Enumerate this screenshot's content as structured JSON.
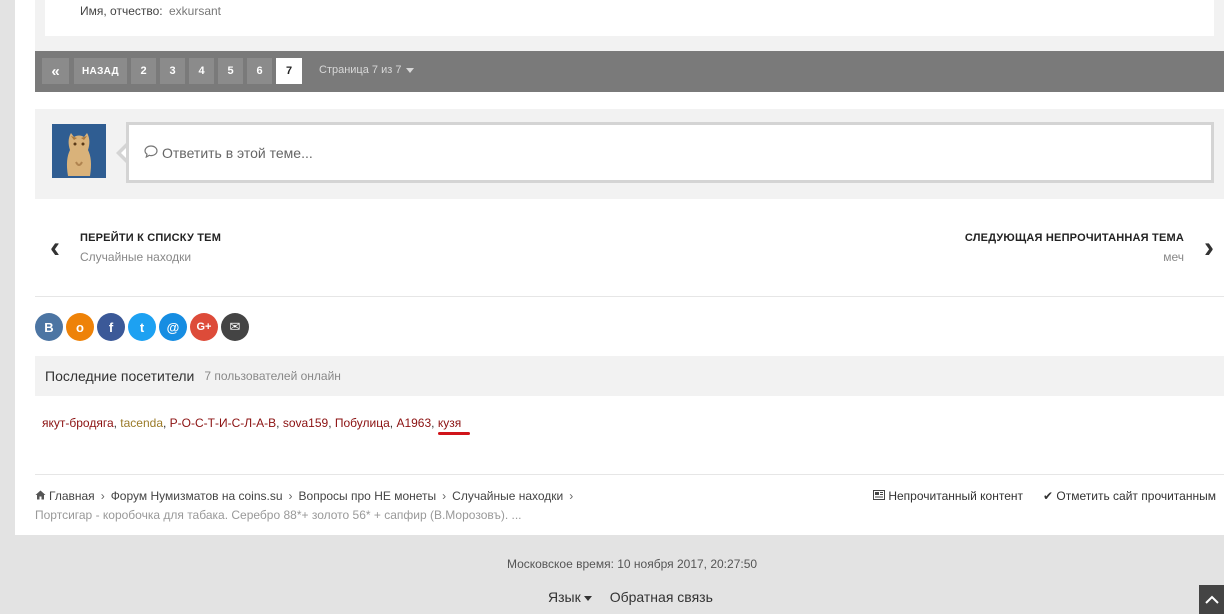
{
  "profile": {
    "label": "Имя, отчество:",
    "value": "exkursant"
  },
  "pagination": {
    "first_icon": "«",
    "back_label": "НАЗАД",
    "pages": [
      "2",
      "3",
      "4",
      "5",
      "6",
      "7"
    ],
    "active_page": "7",
    "page_info": "Страница 7 из 7"
  },
  "reply": {
    "placeholder": "Ответить в этой теме..."
  },
  "nav": {
    "prev_title": "ПЕРЕЙТИ К СПИСКУ ТЕМ",
    "prev_sub": "Случайные находки",
    "next_title": "СЛЕДУЮЩАЯ НЕПРОЧИТАННАЯ ТЕМА",
    "next_sub": "меч"
  },
  "social": [
    {
      "name": "vk",
      "glyph": "В",
      "color": "#4c75a3"
    },
    {
      "name": "odnoklassniki",
      "glyph": "о",
      "color": "#ee8208"
    },
    {
      "name": "facebook",
      "glyph": "f",
      "color": "#3b5998"
    },
    {
      "name": "twitter",
      "glyph": "t",
      "color": "#1da1f2"
    },
    {
      "name": "mail",
      "glyph": "@",
      "color": "#168de2"
    },
    {
      "name": "google-plus",
      "glyph": "G+",
      "color": "#dd4b39"
    },
    {
      "name": "email",
      "glyph": "✉",
      "color": "#444444"
    }
  ],
  "visitors": {
    "title": "Последние посетители",
    "count": "7 пользователей онлайн",
    "users": [
      "якут-бродяга",
      "tacenda",
      "Р-О-С-Т-И-С-Л-А-В",
      "sova159",
      "Побулица",
      "А1963",
      "кузя"
    ]
  },
  "breadcrumb": {
    "items": [
      "Главная",
      "Форум Нумизматов на coins.su",
      "Вопросы про НЕ монеты",
      "Случайные находки"
    ],
    "topic": "Портсигар - коробочка для табака. Серебро 88*+ золото 56* + сапфир (В.Морозовъ). ..."
  },
  "right_links": {
    "unread": "Непрочитанный контент",
    "mark_read": "Отметить сайт прочитанным"
  },
  "footer": {
    "time": "Московское время: 10 ноября 2017, 20:27:50",
    "language": "Язык",
    "feedback": "Обратная связь"
  }
}
